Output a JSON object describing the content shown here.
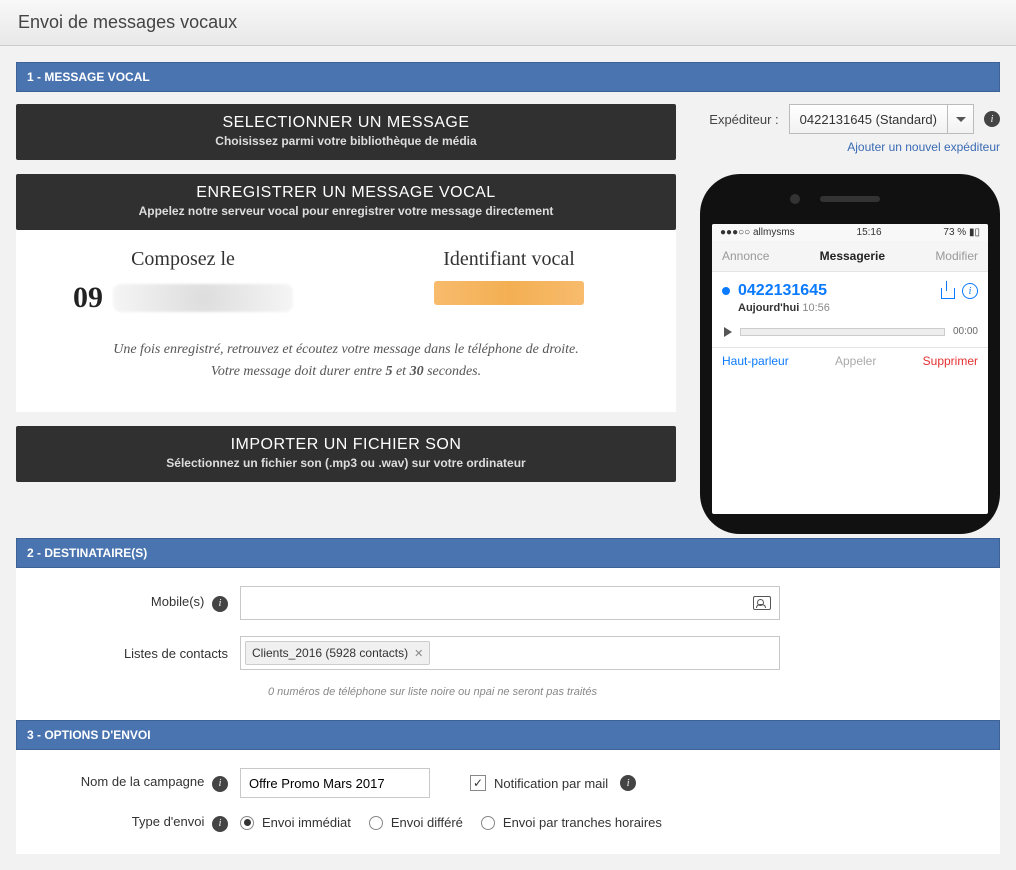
{
  "header": {
    "title": "Envoi de messages vocaux"
  },
  "sections": {
    "s1": "1 - MESSAGE VOCAL",
    "s2": "2 - DESTINATAIRE(S)",
    "s3": "3 - OPTIONS D'ENVOI"
  },
  "panels": {
    "select_title": "SELECTIONNER UN MESSAGE",
    "select_sub": "Choisissez parmi votre bibliothèque de média",
    "record_title": "ENREGISTRER UN MESSAGE VOCAL",
    "record_sub": "Appelez notre serveur vocal pour enregistrer votre message directement",
    "import_title": "IMPORTER UN FICHIER SON",
    "import_sub": "Sélectionnez un fichier son (.mp3 ou .wav) sur votre ordinateur"
  },
  "compose": {
    "col1_label": "Composez le",
    "col2_label": "Identifiant vocal",
    "num_prefix": "09",
    "note_line1": "Une fois enregistré, retrouvez et écoutez votre message dans le téléphone de droite.",
    "note_line2_a": "Votre message doit durer entre ",
    "note_line2_b": "5",
    "note_line2_c": " et ",
    "note_line2_d": "30",
    "note_line2_e": " secondes."
  },
  "expediteur": {
    "label": "Expéditeur :",
    "selected": "0422131645 (Standard)",
    "add_link": "Ajouter un nouvel expéditeur"
  },
  "phone": {
    "carrier": "●●●○○  allmysms",
    "time": "15:16",
    "battery": "73 %",
    "nav_left": "Annonce",
    "nav_mid": "Messagerie",
    "nav_right": "Modifier",
    "number": "0422131645",
    "today_label": "Aujourd'hui",
    "today_time": "10:56",
    "play_time": "00:00",
    "action_speaker": "Haut-parleur",
    "action_call": "Appeler",
    "action_delete": "Supprimer"
  },
  "recipients": {
    "mobile_label": "Mobile(s)",
    "lists_label": "Listes de contacts",
    "chip_text": "Clients_2016 (5928 contacts)",
    "helper": "0 numéros de téléphone sur liste noire ou npai ne seront pas traités"
  },
  "options": {
    "campaign_label": "Nom de la campagne",
    "campaign_value": "Offre Promo Mars 2017",
    "notif_label": "Notification par mail",
    "type_label": "Type d'envoi",
    "radio_now": "Envoi immédiat",
    "radio_later": "Envoi différé",
    "radio_slots": "Envoi par tranches horaires"
  }
}
